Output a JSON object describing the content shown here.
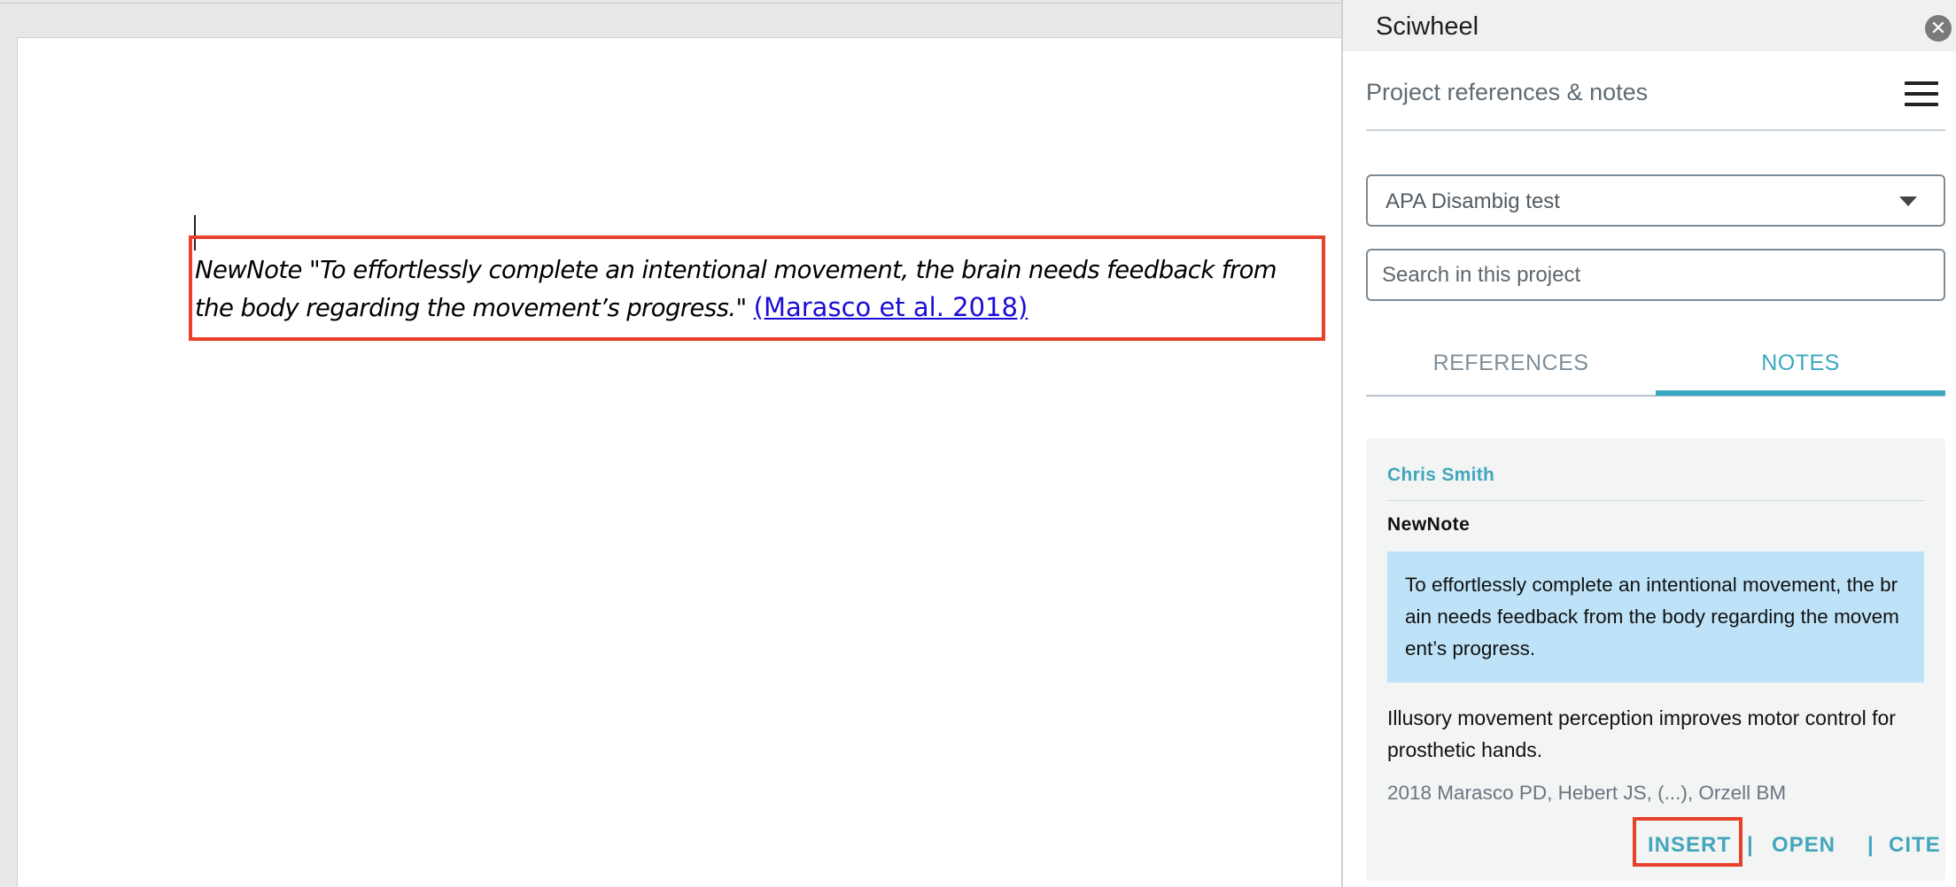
{
  "document": {
    "inserted_note": {
      "line1": "NewNote \"To effortlessly complete an intentional movement, the brain needs feedback from",
      "line2": "the body regarding the movement’s progress.\" ",
      "citation": "(Marasco et al. 2018)"
    }
  },
  "sidebar": {
    "title": "Sciwheel",
    "close_icon": "close-icon",
    "panel_heading": "Project references & notes",
    "menu_icon": "hamburger-menu-icon",
    "project_select": {
      "value": "APA Disambig test"
    },
    "search": {
      "placeholder": "Search in this project",
      "value": ""
    },
    "tabs": [
      {
        "label": "REFERENCES",
        "active": false
      },
      {
        "label": "NOTES",
        "active": true
      }
    ],
    "note": {
      "author": "Chris Smith",
      "title": "NewNote",
      "quote": "To effortlessly complete an intentional movement, the brain needs feedback from the body regarding the movement’s progress.",
      "reference_title": "Illusory movement perception improves motor control for prosthetic hands.",
      "reference_authors": "2018 Marasco PD, Hebert JS, (...), Orzell BM",
      "actions": {
        "insert": "INSERT",
        "open": "OPEN",
        "cite": "CITE",
        "separator": "|"
      }
    }
  },
  "colors": {
    "accent": "#3aa8c1",
    "highlight_box": "#e8402a",
    "quote_bg": "#bee3f8",
    "link": "#1a0dd6"
  }
}
